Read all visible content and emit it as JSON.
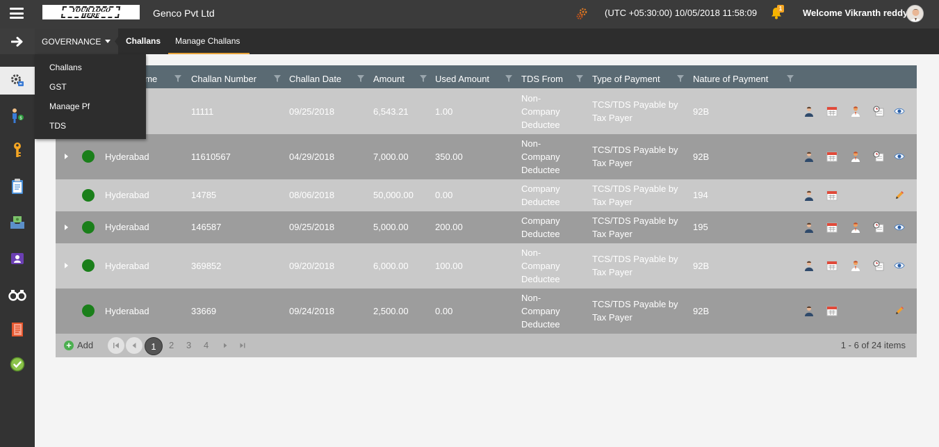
{
  "header": {
    "logo_line1": "YOUR LOGO",
    "logo_line2": "HERE",
    "company": "Genco Pvt Ltd",
    "datetime": "(UTC +05:30:00) 10/05/2018 11:58:09",
    "notification_count": "1",
    "welcome": "Welcome Vikranth reddy"
  },
  "subnav": {
    "menu": "GOVERNANCE",
    "crumbs": [
      "Challans",
      "Manage Challans"
    ]
  },
  "dropdown": {
    "items": [
      "Challans",
      "GST",
      "Manage Pf",
      "TDS"
    ]
  },
  "sidebar": {
    "icons": [
      "settings-icon",
      "person-money-icon",
      "key-icon",
      "clipboard-icon",
      "money-inbox-icon",
      "contact-card-icon",
      "binoculars-icon",
      "ledger-icon",
      "check-circle-icon"
    ]
  },
  "grid": {
    "columns": [
      "ame",
      "Challan Number",
      "Challan Date",
      "Amount",
      "Used Amount",
      "TDS From",
      "Type of Payment",
      "Nature of Payment"
    ],
    "rows": [
      {
        "name": "d",
        "number": "11111",
        "date": "09/25/2018",
        "amount": "6,543.21",
        "used": "1.00",
        "tds_from": "Non-Company Deductee",
        "payment_type": "TCS/TDS Payable by Tax Payer",
        "nature": "92B"
      },
      {
        "name": "Hyderabad",
        "number": "11610567",
        "date": "04/29/2018",
        "amount": "7,000.00",
        "used": "350.00",
        "tds_from": "Non-Company Deductee",
        "payment_type": "TCS/TDS Payable by Tax Payer",
        "nature": "92B"
      },
      {
        "name": "Hyderabad",
        "number": "14785",
        "date": "08/06/2018",
        "amount": "50,000.00",
        "used": "0.00",
        "tds_from": "Company Deductee",
        "payment_type": "TCS/TDS Payable by Tax Payer",
        "nature": "194"
      },
      {
        "name": "Hyderabad",
        "number": "146587",
        "date": "09/25/2018",
        "amount": "5,000.00",
        "used": "200.00",
        "tds_from": "Company Deductee",
        "payment_type": "TCS/TDS Payable by Tax Payer",
        "nature": "195"
      },
      {
        "name": "Hyderabad",
        "number": "369852",
        "date": "09/20/2018",
        "amount": "6,000.00",
        "used": "100.00",
        "tds_from": "Non-Company Deductee",
        "payment_type": "TCS/TDS Payable by Tax Payer",
        "nature": "92B"
      },
      {
        "name": "Hyderabad",
        "number": "33669",
        "date": "09/24/2018",
        "amount": "2,500.00",
        "used": "0.00",
        "tds_from": "Non-Company Deductee",
        "payment_type": "TCS/TDS Payable by Tax Payer",
        "nature": "92B"
      }
    ]
  },
  "footer": {
    "add_label": "Add",
    "pages": [
      "1",
      "2",
      "3",
      "4"
    ],
    "current_page": "1",
    "items_info": "1 - 6 of 24 items"
  },
  "colors": {
    "topbar": "#3b3b3b",
    "subbar": "#2d2d2d",
    "sidebar": "#333333",
    "grid_header": "#5a6a73",
    "row_light": "#c9c9c9",
    "row_dark": "#9d9d9d",
    "status_green": "#1a7f1a",
    "accent_orange": "#e8a33a"
  }
}
